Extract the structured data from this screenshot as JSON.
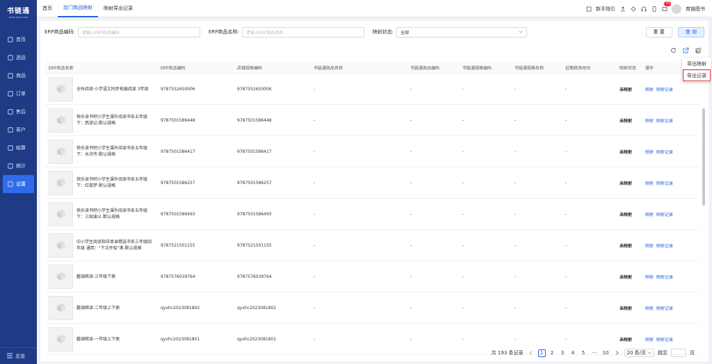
{
  "sidebar": {
    "logo_main": "书链通",
    "logo_sub": "BOOK LINK CHAIN",
    "items": [
      {
        "label": "首页",
        "icon": "monitor-icon"
      },
      {
        "label": "选品",
        "icon": "select-icon"
      },
      {
        "label": "商品",
        "icon": "goods-icon"
      },
      {
        "label": "订单",
        "icon": "order-icon"
      },
      {
        "label": "售后",
        "icon": "aftersale-icon"
      },
      {
        "label": "客户",
        "icon": "customer-icon"
      },
      {
        "label": "结算",
        "icon": "settle-icon"
      },
      {
        "label": "统计",
        "icon": "stats-icon"
      },
      {
        "label": "设置",
        "icon": "settings-icon"
      }
    ],
    "bottom_label": "总览"
  },
  "topbar": {
    "tabs": [
      "首页",
      "店门商品映射",
      "映射导出记录"
    ],
    "guide_label": "新手指引",
    "badge_count": "75",
    "user_name": "育链图书"
  },
  "filters": {
    "erp_code_label": "ERP商品编码:",
    "erp_code_placeholder": "请输入ERP商品编码",
    "erp_name_label": "ERP商品名称:",
    "erp_name_placeholder": "请输入ERP商品名称",
    "status_label": "映射状态:",
    "status_value": "全部",
    "reset_label": "重 置",
    "query_label": "查 询"
  },
  "dropdown": {
    "items": [
      "导出映射",
      "导出记录"
    ]
  },
  "table": {
    "headers": [
      "ERP商品名称",
      "ERP商品编码",
      "店铺规格编码",
      "书链通商品名称",
      "书链通商品编码",
      "书链通规格编码",
      "书链通规格名称",
      "近期修改时间",
      "映射状态",
      "操作"
    ],
    "rows": [
      {
        "name": "全科阅读·小学语文同步拓展阅读 3年级",
        "code": "9787552650006",
        "store": "9787552650006",
        "sname": "-",
        "sgname": "-",
        "sgcode": "-",
        "sgspec": "-",
        "time": "-",
        "status": "未映射",
        "op1": "映射",
        "op2": "映射记录"
      },
      {
        "name": "快乐读书吧小学生课外阅读书系五年级下：西游记-默认规格",
        "code": "9787501586448",
        "store": "9787501586448",
        "sname": "-",
        "sgname": "-",
        "sgcode": "-",
        "sgspec": "-",
        "time": "-",
        "status": "未映射",
        "op1": "映射",
        "op2": "映射记录"
      },
      {
        "name": "快乐读书吧小学生课外阅读书系五年级下：水浒传-默认规格",
        "code": "9787501586417",
        "store": "9787501586417",
        "sname": "-",
        "sgname": "-",
        "sgcode": "-",
        "sgspec": "-",
        "time": "-",
        "status": "未映射",
        "op1": "映射",
        "op2": "映射记录"
      },
      {
        "name": "快乐读书吧小学生课外阅读书系五年级下：红楼梦-默认规格",
        "code": "9787501586257",
        "store": "9787501586257",
        "sname": "-",
        "sgname": "-",
        "sgcode": "-",
        "sgspec": "-",
        "time": "-",
        "status": "未映射",
        "op1": "映射",
        "op2": "映射记录"
      },
      {
        "name": "快乐读书吧小学生课外阅读书系五年级下：三国演义-默认规格",
        "code": "9787501586493",
        "store": "9787501586493",
        "sname": "-",
        "sgname": "-",
        "sgcode": "-",
        "sgspec": "-",
        "time": "-",
        "status": "未映射",
        "op1": "映射",
        "op2": "映射记录"
      },
      {
        "name": "中小学生阅读指导目录精选书系三年级四年级 通用：\"下次开船\"港-默认规格",
        "code": "9787521501155",
        "store": "9787521501155",
        "sname": "-",
        "sgname": "-",
        "sgcode": "-",
        "sgspec": "-",
        "time": "-",
        "status": "未映射",
        "op1": "映射",
        "op2": "映射记录"
      },
      {
        "name": "趣调暗读-三年级下册",
        "code": "9787576039764",
        "store": "9787576039764",
        "sname": "-",
        "sgname": "-",
        "sgcode": "-",
        "sgspec": "-",
        "time": "-",
        "status": "未映射",
        "op1": "映射",
        "op2": "映射记录"
      },
      {
        "name": "趣调暗读-二年级上下册",
        "code": "qyxhc2023081802",
        "store": "qyxhc2023081802",
        "sname": "-",
        "sgname": "-",
        "sgcode": "-",
        "sgspec": "-",
        "time": "-",
        "status": "未映射",
        "op1": "映射",
        "op2": "映射记录"
      },
      {
        "name": "趣调暗读-一年级上下册",
        "code": "qyxhc2023081801",
        "store": "qyxhc2023081801",
        "sname": "-",
        "sgname": "-",
        "sgcode": "-",
        "sgspec": "-",
        "time": "-",
        "status": "未映射",
        "op1": "映射",
        "op2": "映射记录"
      }
    ]
  },
  "pager": {
    "total": "共 193 条记录",
    "pages": [
      "1",
      "2",
      "3",
      "4",
      "5"
    ],
    "ellipsis": "···",
    "last": "10",
    "size": "20 条/页",
    "jump_label": "跳至",
    "page_unit": "页"
  }
}
